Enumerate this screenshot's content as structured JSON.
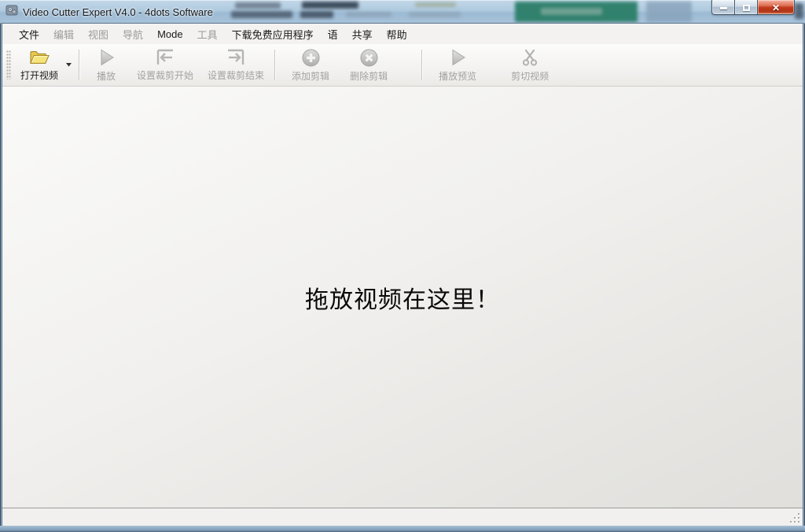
{
  "window": {
    "title": "Video Cutter Expert V4.0 - 4dots Software",
    "controls": [
      {
        "name": "minimize",
        "icon": "minimize-icon"
      },
      {
        "name": "maximize",
        "icon": "maximize-icon"
      },
      {
        "name": "close",
        "icon": "close-icon"
      }
    ]
  },
  "menu": {
    "items": [
      {
        "label": "文件",
        "enabled": true
      },
      {
        "label": "编辑",
        "enabled": false
      },
      {
        "label": "视图",
        "enabled": false
      },
      {
        "label": "导航",
        "enabled": false
      },
      {
        "label": "Mode",
        "enabled": true
      },
      {
        "label": "工具",
        "enabled": false
      },
      {
        "label": "下载免费应用程序",
        "enabled": true
      },
      {
        "label": "语",
        "enabled": true
      },
      {
        "label": "共享",
        "enabled": true
      },
      {
        "label": "帮助",
        "enabled": true
      }
    ]
  },
  "toolbar": {
    "buttons": [
      {
        "label": "打开视频",
        "icon": "folder-open-icon",
        "enabled": true,
        "has_dropdown": true
      },
      {
        "label": "播放",
        "icon": "play-icon",
        "enabled": false
      },
      {
        "label": "设置裁剪开始",
        "icon": "set-cut-start-icon",
        "enabled": false
      },
      {
        "label": "设置裁剪结束",
        "icon": "set-cut-end-icon",
        "enabled": false
      },
      {
        "label": "添加剪辑",
        "icon": "add-clip-icon",
        "enabled": false
      },
      {
        "label": "删除剪辑",
        "icon": "delete-clip-icon",
        "enabled": false
      },
      {
        "label": "播放预览",
        "icon": "play-preview-icon",
        "enabled": false
      },
      {
        "label": "剪切视频",
        "icon": "scissors-icon",
        "enabled": false
      }
    ]
  },
  "main": {
    "drop_hint": "拖放视频在这里！"
  },
  "colors": {
    "aero_glass": "#a8c3da",
    "close_button_red": "#c23a1d",
    "folder_yellow": "#f0d35a",
    "disabled_gray": "#a3a2a0",
    "background_green_artifact": "#2b7e68"
  }
}
